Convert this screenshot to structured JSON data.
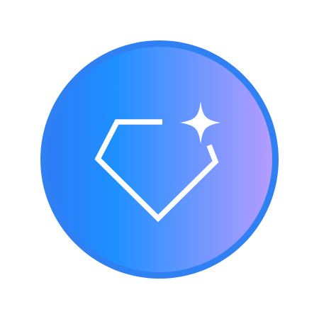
{
  "app": {
    "name": ""
  },
  "logo": {
    "icon": "diamond-sparkle-icon",
    "colors": {
      "ring": "#2F80F2",
      "gradient_start": "#2C7CF6",
      "gradient_mid": "#1E90FF",
      "gradient_end": "#B59CFF",
      "glyph": "#FFFFFF"
    }
  }
}
